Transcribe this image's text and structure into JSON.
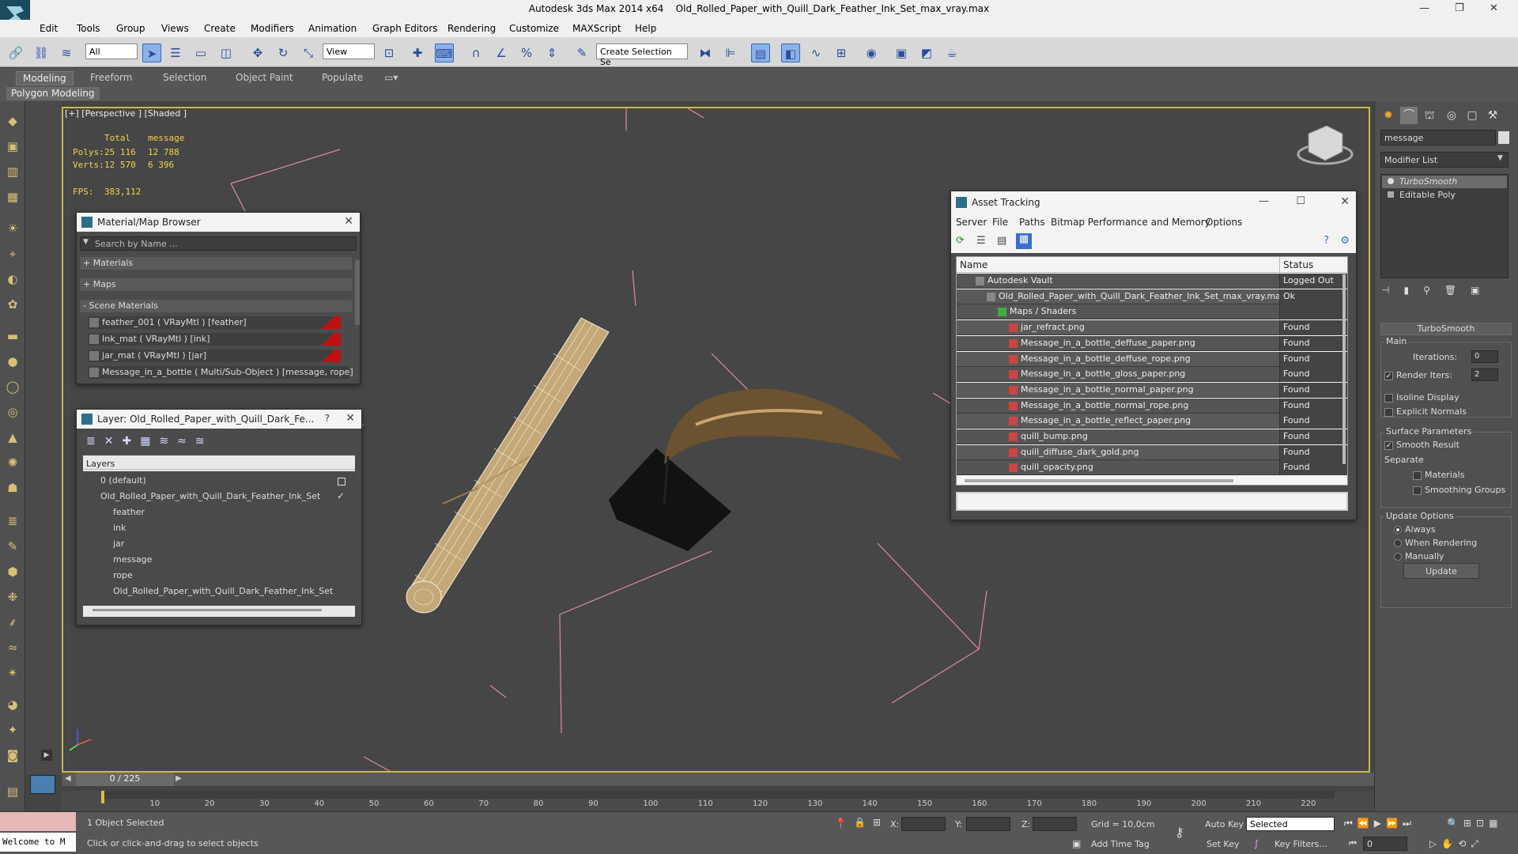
{
  "title_bar": {
    "app": "Autodesk 3ds Max  2014 x64",
    "file": "Old_Rolled_Paper_with_Quill_Dark_Feather_Ink_Set_max_vray.max",
    "minimize": "—",
    "restore": "❐",
    "close": "✕"
  },
  "menu": [
    "Edit",
    "Tools",
    "Group",
    "Views",
    "Create",
    "Modifiers",
    "Animation",
    "Graph Editors",
    "Rendering",
    "Customize",
    "MAXScript",
    "Help"
  ],
  "toolbar": {
    "selection_filter": "All",
    "ref_coord": "View",
    "named_selection": "Create Selection Se"
  },
  "ribbon": {
    "tabs": [
      "Modeling",
      "Freeform",
      "Selection",
      "Object Paint",
      "Populate"
    ],
    "active_tab": "Modeling",
    "panel": "Polygon Modeling"
  },
  "viewport": {
    "label": "[+] [Perspective ] [Shaded ]",
    "stats": {
      "col_total": "Total",
      "col_selected": "message",
      "polys_label": "Polys:",
      "polys_total": "25 116",
      "polys_sel": "12 788",
      "verts_label": "Verts:",
      "verts_total": "12 570",
      "verts_sel": "6 396",
      "fps_label": "FPS:",
      "fps": "383,112"
    }
  },
  "material_browser": {
    "title": "Material/Map Browser",
    "search_placeholder": "Search by Name ...",
    "sections": [
      "+ Materials",
      "+ Maps",
      "- Scene Materials"
    ],
    "materials": [
      "feather_001  ( VRayMtl ) [feather]",
      "Ink_mat  ( VRayMtl ) [ink]",
      "jar_mat  ( VRayMtl ) [jar]",
      "Message_in_a_bottle  ( Multi/Sub-Object ) [message, rope]"
    ]
  },
  "layer_window": {
    "title": "Layer: Old_Rolled_Paper_with_Quill_Dark_Fe...",
    "help": "?",
    "header": "Layers",
    "layers": [
      {
        "name": "0 (default)",
        "indent": 1
      },
      {
        "name": "Old_Rolled_Paper_with_Quill_Dark_Feather_Ink_Set",
        "indent": 1
      },
      {
        "name": "feather",
        "indent": 2
      },
      {
        "name": "ink",
        "indent": 2
      },
      {
        "name": "jar",
        "indent": 2
      },
      {
        "name": "message",
        "indent": 2
      },
      {
        "name": "rope",
        "indent": 2
      },
      {
        "name": "Old_Rolled_Paper_with_Quill_Dark_Feather_Ink_Set",
        "indent": 2
      }
    ]
  },
  "asset_tracking": {
    "title": "Asset Tracking",
    "menu": [
      "Server",
      "File",
      "Paths",
      "Bitmap Performance and Memory",
      "Options"
    ],
    "col_name": "Name",
    "col_status": "Status",
    "rows": [
      {
        "name": "Autodesk Vault",
        "status": "Logged Out",
        "indent": 1
      },
      {
        "name": "Old_Rolled_Paper_with_Quill_Dark_Feather_Ink_Set_max_vray.max",
        "status": "Ok",
        "indent": 2
      },
      {
        "name": "Maps / Shaders",
        "status": "",
        "indent": 3
      },
      {
        "name": "jar_refract.png",
        "status": "Found",
        "indent": 4
      },
      {
        "name": "Message_in_a_bottle_deffuse_paper.png",
        "status": "Found",
        "indent": 4
      },
      {
        "name": "Message_in_a_bottle_deffuse_rope.png",
        "status": "Found",
        "indent": 4
      },
      {
        "name": "Message_in_a_bottle_gloss_paper.png",
        "status": "Found",
        "indent": 4
      },
      {
        "name": "Message_in_a_bottle_normal_paper.png",
        "status": "Found",
        "indent": 4
      },
      {
        "name": "Message_in_a_bottle_normal_rope.png",
        "status": "Found",
        "indent": 4
      },
      {
        "name": "Message_in_a_bottle_reflect_paper.png",
        "status": "Found",
        "indent": 4
      },
      {
        "name": "quill_bump.png",
        "status": "Found",
        "indent": 4
      },
      {
        "name": "quill_diffuse_dark_gold.png",
        "status": "Found",
        "indent": 4
      },
      {
        "name": "quill_opacity.png",
        "status": "Found",
        "indent": 4
      }
    ]
  },
  "command_panel": {
    "object_name": "message",
    "modifier_list": "Modifier List",
    "stack": [
      "TurboSmooth",
      "Editable Poly"
    ],
    "rollout_title": "TurboSmooth",
    "main": "Main",
    "iterations_label": "Iterations:",
    "iterations": "0",
    "render_iters_label": "Render Iters:",
    "render_iters": "2",
    "isoline": "Isoline Display",
    "explicit": "Explicit Normals",
    "surface_params": "Surface Parameters",
    "smooth_result": "Smooth Result",
    "separate": "Separate",
    "materials": "Materials",
    "smoothing_groups": "Smoothing Groups",
    "update_options": "Update Options",
    "always": "Always",
    "when_rendering": "When Rendering",
    "manually": "Manually",
    "update_btn": "Update"
  },
  "timeline": {
    "frame": "0 / 225",
    "ticks": [
      "10",
      "20",
      "30",
      "40",
      "50",
      "60",
      "70",
      "80",
      "90",
      "100",
      "110",
      "120",
      "130",
      "140",
      "150",
      "160",
      "170",
      "180",
      "190",
      "200",
      "210",
      "220"
    ]
  },
  "statusbar": {
    "script": "Welcome to M",
    "selected": "1 Object Selected",
    "prompt": "Click or click-and-drag to select objects",
    "x": "X:",
    "y": "Y:",
    "z": "Z:",
    "grid": "Grid = 10,0cm",
    "auto_key": "Auto Key",
    "set_key": "Set Key",
    "key_mode": "Selected",
    "key_filters": "Key Filters...",
    "add_time_tag": "Add Time Tag",
    "frame_field": "0"
  }
}
